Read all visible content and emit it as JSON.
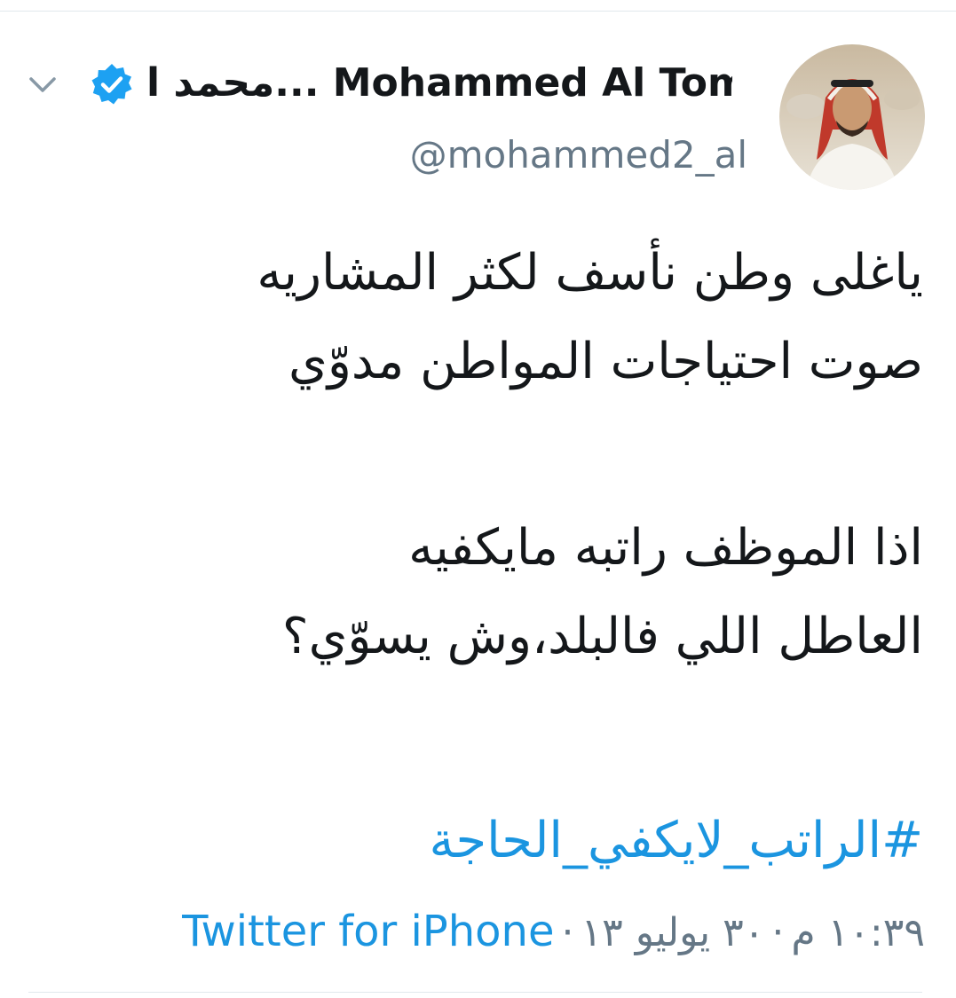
{
  "tweet": {
    "display_name": "محمد ا... Mohammed Al Tom",
    "handle": "@mohammed2_al",
    "verified": true,
    "lines": [
      "ياغلى وطن نأسف لكثر المشاريه",
      "صوت احتياجات المواطن مدوّي",
      "",
      "اذا الموظف راتبه  مايكفيه",
      "العاطل اللي فالبلد،وش يسوّي؟"
    ],
    "hashtag": "#الراتب_لايكفي_الحاجة",
    "time": "١٠:٣٩ م",
    "date": "٣٠ يوليو ١٣",
    "separator": "·",
    "source": "Twitter for iPhone"
  },
  "colors": {
    "link": "#1b95e0",
    "verified": "#1da1f2",
    "muted": "#657786",
    "text": "#14171a"
  },
  "icons": {
    "menu": "chevron-down-icon",
    "verified": "verified-badge-icon"
  }
}
